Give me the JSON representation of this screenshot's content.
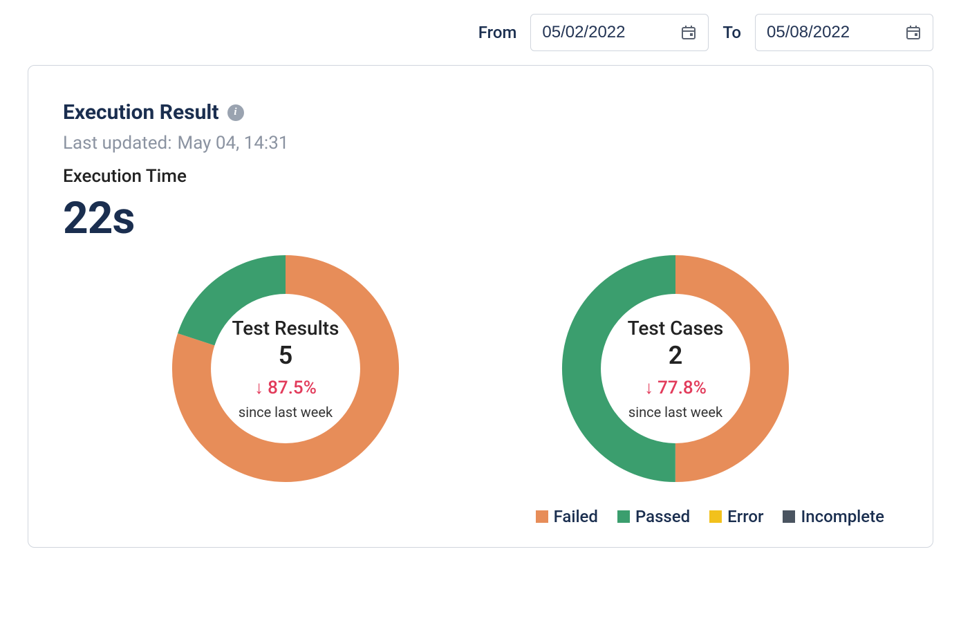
{
  "dateFilter": {
    "fromLabel": "From",
    "toLabel": "To",
    "fromValue": "05/02/2022",
    "toValue": "05/08/2022"
  },
  "panel": {
    "title": "Execution Result",
    "lastUpdatedLabel": "Last updated:",
    "lastUpdatedValue": "May 04, 14:31",
    "execTimeLabel": "Execution Time",
    "execTimeValue": "22s"
  },
  "legend": {
    "failed": {
      "label": "Failed",
      "color": "#e78d59"
    },
    "passed": {
      "label": "Passed",
      "color": "#3b9e6e"
    },
    "error": {
      "label": "Error",
      "color": "#f2c11c"
    },
    "incomplete": {
      "label": "Incomplete",
      "color": "#4a5460"
    }
  },
  "donuts": {
    "results": {
      "title": "Test Results",
      "count": "5",
      "changePct": "87.5%",
      "changeDir": "down",
      "sinceLabel": "since last week"
    },
    "cases": {
      "title": "Test Cases",
      "count": "2",
      "changePct": "77.8%",
      "changeDir": "down",
      "sinceLabel": "since last week"
    }
  },
  "chart_data": [
    {
      "type": "pie",
      "title": "Test Results",
      "total": 5,
      "change_percent": -87.5,
      "change_reference": "since last week",
      "series": [
        {
          "name": "Failed",
          "value": 4,
          "color": "#e78d59"
        },
        {
          "name": "Passed",
          "value": 1,
          "color": "#3b9e6e"
        },
        {
          "name": "Error",
          "value": 0,
          "color": "#f2c11c"
        },
        {
          "name": "Incomplete",
          "value": 0,
          "color": "#4a5460"
        }
      ]
    },
    {
      "type": "pie",
      "title": "Test Cases",
      "total": 2,
      "change_percent": -77.8,
      "change_reference": "since last week",
      "series": [
        {
          "name": "Failed",
          "value": 1,
          "color": "#e78d59"
        },
        {
          "name": "Passed",
          "value": 1,
          "color": "#3b9e6e"
        },
        {
          "name": "Error",
          "value": 0,
          "color": "#f2c11c"
        },
        {
          "name": "Incomplete",
          "value": 0,
          "color": "#4a5460"
        }
      ]
    }
  ]
}
